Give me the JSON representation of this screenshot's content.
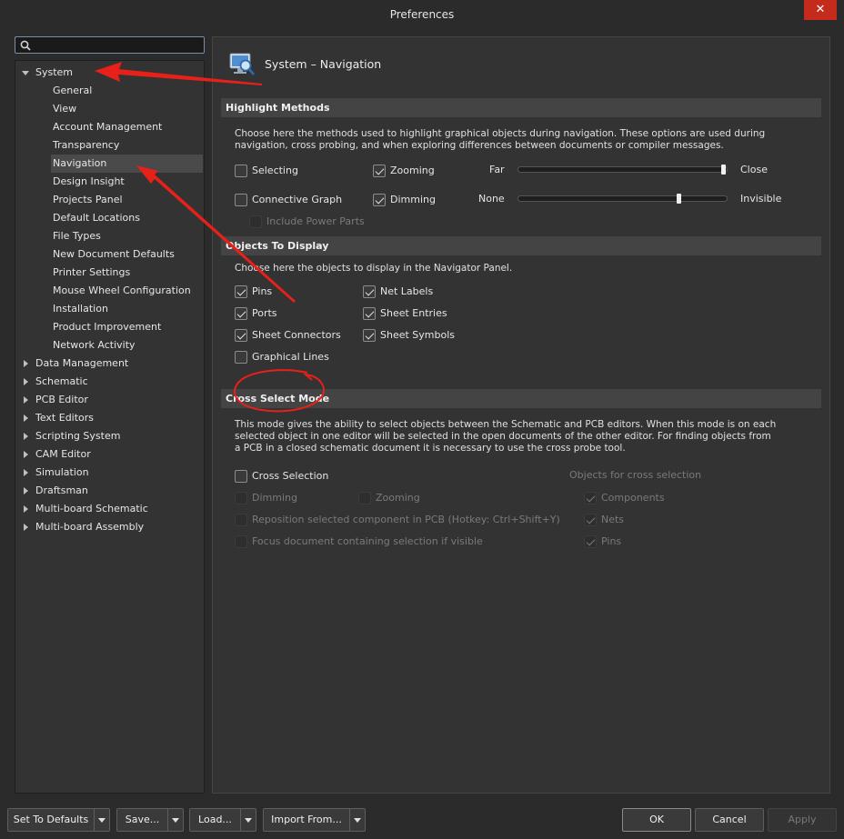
{
  "window": {
    "title": "Preferences",
    "close_label": "✕"
  },
  "search": {
    "placeholder": ""
  },
  "tree": {
    "system_label": "System",
    "system_children": [
      "General",
      "View",
      "Account Management",
      "Transparency",
      "Navigation",
      "Design Insight",
      "Projects Panel",
      "Default Locations",
      "File Types",
      "New Document Defaults",
      "Printer Settings",
      "Mouse Wheel Configuration",
      "Installation",
      "Product Improvement",
      "Network Activity"
    ],
    "selected": "Navigation",
    "top_level": [
      "Data Management",
      "Schematic",
      "PCB Editor",
      "Text Editors",
      "Scripting System",
      "CAM Editor",
      "Simulation",
      "Draftsman",
      "Multi-board Schematic",
      "Multi-board Assembly"
    ]
  },
  "page": {
    "title": "System – Navigation"
  },
  "highlight": {
    "header": "Highlight Methods",
    "desc_line1": "Choose here the methods used to highlight graphical objects during navigation. These options are used during",
    "desc_line2": "navigation, cross probing, and when exploring differences between documents or compiler messages.",
    "selecting": {
      "label": "Selecting",
      "checked": false
    },
    "zooming": {
      "label": "Zooming",
      "checked": true
    },
    "connective_graph": {
      "label": "Connective Graph",
      "checked": false
    },
    "dimming": {
      "label": "Dimming",
      "checked": true
    },
    "include_power_parts": {
      "label": "Include Power Parts",
      "checked": false
    },
    "zoom_slider": {
      "min_label": "Far",
      "max_label": "Close",
      "value": 1.0
    },
    "dim_slider": {
      "min_label": "None",
      "max_label": "Invisible",
      "value": 0.78
    }
  },
  "objects": {
    "header": "Objects To Display",
    "desc": "Choose here the objects to display in the Navigator Panel.",
    "pins": "Pins",
    "ports": "Ports",
    "sheet_connectors": "Sheet Connectors",
    "graphical_lines": "Graphical Lines",
    "net_labels": "Net Labels",
    "sheet_entries": "Sheet Entries",
    "sheet_symbols": "Sheet Symbols"
  },
  "cross": {
    "header": "Cross Select Mode",
    "desc_line1": "This mode gives the ability to select objects between the Schematic and PCB editors.  When this mode is on each",
    "desc_line2": "selected object in one editor will be selected in the open documents of the other editor.  For finding objects from",
    "desc_line3": "a PCB in a closed schematic document it is necessary to use the cross probe tool.",
    "cross_selection": "Cross Selection",
    "dimming": "Dimming",
    "zooming": "Zooming",
    "reposition": "Reposition selected component in PCB (Hotkey: Ctrl+Shift+Y)",
    "focus": "Focus document containing selection if visible",
    "objects_header": "Objects for cross selection",
    "components": "Components",
    "nets": "Nets",
    "pins": "Pins"
  },
  "buttons": {
    "set_defaults": "Set To Defaults",
    "save": "Save...",
    "load": "Load...",
    "import_from": "Import From...",
    "ok": "OK",
    "cancel": "Cancel",
    "apply": "Apply"
  },
  "colors": {
    "annotation": "#e8201a",
    "background": "#2b2b2b",
    "panel": "#333333",
    "section": "#444444"
  }
}
